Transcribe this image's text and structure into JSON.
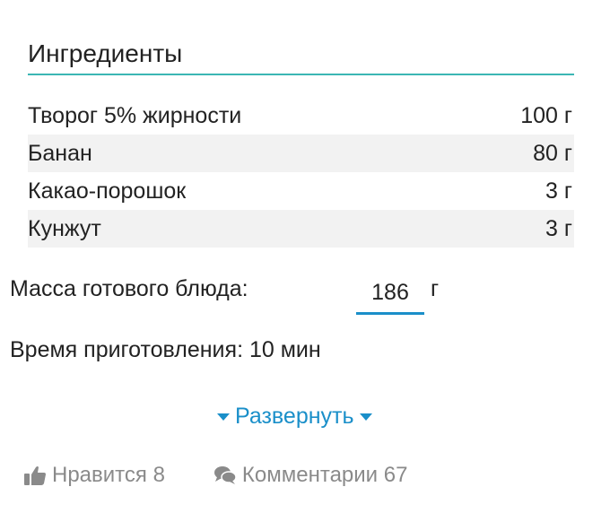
{
  "ingredients": {
    "title": "Ингредиенты",
    "items": [
      {
        "name": "Творог 5% жирности",
        "amount": "100 г"
      },
      {
        "name": "Банан",
        "amount": "80 г"
      },
      {
        "name": "Какао-порошок",
        "amount": "3 г"
      },
      {
        "name": "Кунжут",
        "amount": "3 г"
      }
    ]
  },
  "mass": {
    "label": "Масса готового блюда:",
    "value": "186",
    "unit": "г"
  },
  "time": {
    "label": "Время приготовления: 10 мин"
  },
  "expand": {
    "label": "Развернуть"
  },
  "footer": {
    "likes_label": "Нравится 8",
    "comments_label": "Комментарии 67"
  },
  "colors": {
    "accent": "#1a8fc9",
    "underline": "#3bb6b4",
    "muted": "#8a8a8a"
  },
  "icons": {
    "likes": "thumbs-up-icon",
    "comments": "comments-icon",
    "expand": "caret-down-icon"
  }
}
